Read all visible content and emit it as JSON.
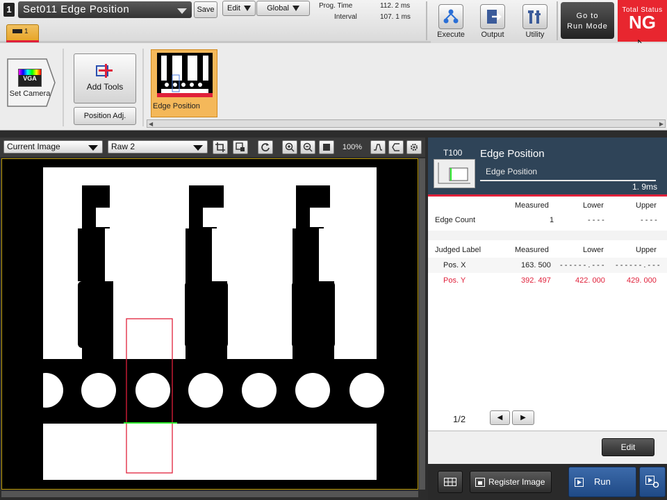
{
  "topbar": {
    "set_number": "1",
    "set_name": "Set011  Edge  Position",
    "save_label": "Save",
    "edit_label": "Edit",
    "global_label": "Global",
    "prog_time_label": "Prog.  Time",
    "prog_time_value": "112. 2  ms",
    "interval_label": "Interval",
    "interval_value": "107. 1  ms",
    "execute_label": "Execute",
    "output_label": "Output",
    "utility_label": "Utility",
    "go_to_run_line1": "Go  to",
    "go_to_run_line2": "Run  Mode",
    "total_status_label": "Total Status",
    "total_status_value": "NG",
    "tool_tab_label": "1"
  },
  "flow": {
    "camera_badge": "VGA",
    "set_camera_label": "Set  Camera",
    "add_tools_label": "Add  Tools",
    "position_adj_label": "Position  Adj.",
    "tool_tile_label": "Edge  Position"
  },
  "image_toolbar": {
    "image_select": "Current  Image",
    "raw_select": "Raw  2",
    "zoom_label": "100%"
  },
  "panel": {
    "tool_id": "T100",
    "tool_name": "Edge  Position",
    "tool_subname": "Edge  Position",
    "time": "1. 9ms",
    "header_measured": "Measured",
    "header_lower": "Lower",
    "header_upper": "Upper",
    "edge_count_label": "Edge  Count",
    "edge_count_measured": "1",
    "edge_count_lower": "- - - -",
    "edge_count_upper": "- - - -",
    "judged_label_header": "Judged  Label",
    "rows": [
      {
        "label": "Pos.  X",
        "measured": "163. 500",
        "lower": "- - - - - - . - - -",
        "upper": "- - - - - - . - - -"
      },
      {
        "label": "Pos.  Y",
        "measured": "392. 497",
        "lower": "422. 000",
        "upper": "429. 000"
      }
    ],
    "page_indicator": "1/2",
    "edit_button": "Edit",
    "register_image_label": "Register  Image",
    "run_label": "Run"
  },
  "colors": {
    "ng_red": "#e8262f",
    "tile_orange": "#f4b85a",
    "panel_header": "#2f4458",
    "roi_red": "#e0203a",
    "edge_green": "#2ee82e"
  }
}
